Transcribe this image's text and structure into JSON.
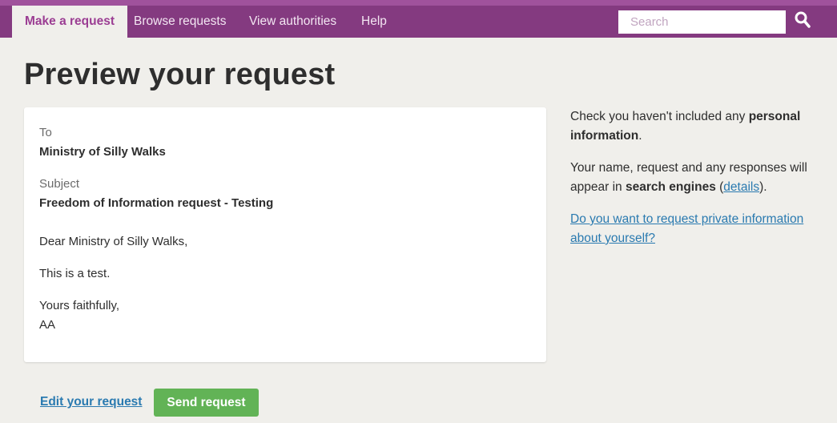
{
  "nav": {
    "tabs": [
      {
        "label": "Make a request",
        "active": true
      },
      {
        "label": "Browse requests",
        "active": false
      },
      {
        "label": "View authorities",
        "active": false
      },
      {
        "label": "Help",
        "active": false
      }
    ],
    "search_placeholder": "Search",
    "search_icon": "magnifier-icon"
  },
  "page": {
    "title": "Preview your request"
  },
  "preview": {
    "to_label": "To",
    "to_value": "Ministry of Silly Walks",
    "subject_label": "Subject",
    "subject_value": "Freedom of Information request - Testing",
    "greeting": "Dear Ministry of Silly Walks,",
    "body": "This is a test.",
    "signoff": "Yours faithfully,",
    "signature": "AA"
  },
  "sidebar": {
    "p1_pre": "Check you haven't included any ",
    "p1_bold": "personal information",
    "p1_post": ".",
    "p2_pre": "Your name, request and any responses will appear in ",
    "p2_bold": "search engines",
    "p2_paren_open": " (",
    "p2_link": "details",
    "p2_paren_close": ").",
    "p3_link": "Do you want to request private information about yourself?"
  },
  "actions": {
    "edit_label": "Edit your request",
    "send_label": "Send request"
  },
  "colors": {
    "nav_bg": "#843a80",
    "accent": "#9b3d93",
    "link": "#2a7ab0",
    "send_button": "#62b356"
  }
}
